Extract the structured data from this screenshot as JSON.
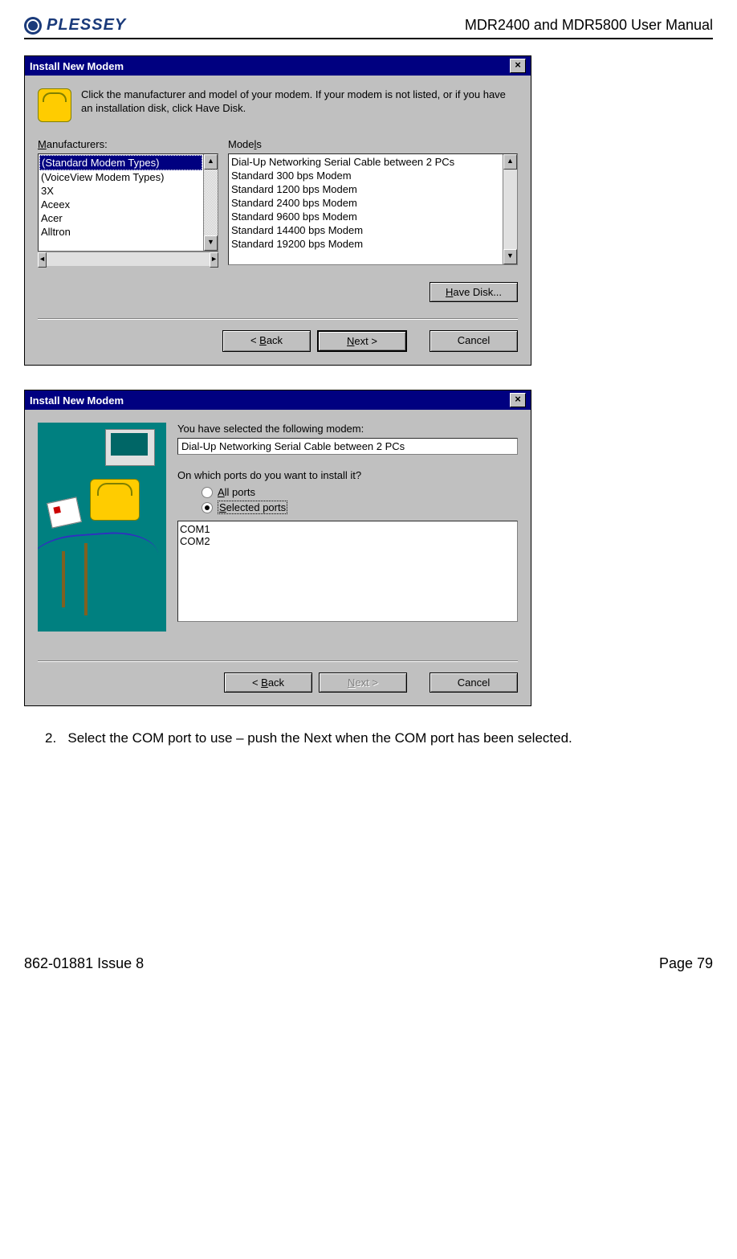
{
  "header": {
    "logo_text": "PLESSEY",
    "title": "MDR2400 and MDR5800 User Manual"
  },
  "dialog1": {
    "title": "Install New Modem",
    "instruction": "Click the manufacturer and model of your modem. If your modem is not listed, or if you have an installation disk, click Have Disk.",
    "manufacturers_label": "Manufacturers:",
    "models_label": "Models",
    "manufacturers": [
      "(Standard Modem Types)",
      "(VoiceView Modem Types)",
      "3X",
      "Aceex",
      "Acer",
      "Alltron"
    ],
    "models": [
      "Dial-Up Networking Serial Cable between 2 PCs",
      "Standard   300 bps Modem",
      "Standard  1200 bps Modem",
      "Standard  2400 bps Modem",
      "Standard  9600 bps Modem",
      "Standard 14400 bps Modem",
      "Standard 19200 bps Modem"
    ],
    "have_disk": "Have Disk...",
    "back": "< Back",
    "next": "Next >",
    "cancel": "Cancel"
  },
  "dialog2": {
    "title": "Install New Modem",
    "selected_label": "You have selected the following modem:",
    "selected_value": "Dial-Up Networking Serial Cable between 2 PCs",
    "ports_question": "On which ports do you want to install it?",
    "all_ports": "All ports",
    "selected_ports": "Selected ports",
    "ports": [
      "COM1",
      "COM2"
    ],
    "back": "< Back",
    "next": "Next >",
    "cancel": "Cancel"
  },
  "instruction": {
    "number": "2.",
    "text": "Select the COM port to use – push the Next when the COM port has been selected."
  },
  "footer": {
    "left": "862-01881 Issue 8",
    "right": "Page 79"
  }
}
